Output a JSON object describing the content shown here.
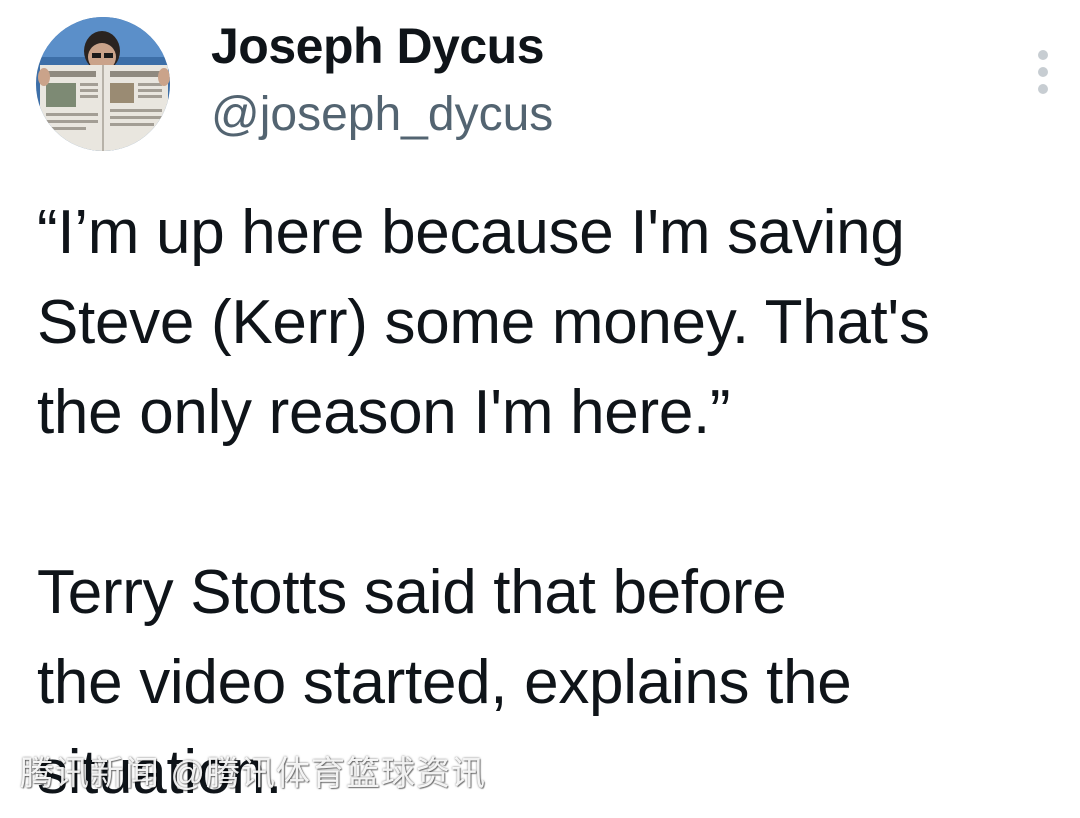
{
  "author": {
    "display_name": "Joseph Dycus",
    "handle": "@joseph_dycus",
    "avatar_icon": "avatar-photo-newspaper"
  },
  "menu": {
    "icon": "more-options-vertical-icon"
  },
  "tweet": {
    "paragraphs": [
      {
        "lines": [
          "“I’m up here because I'm saving",
          "Steve (Kerr) some money. That's",
          "the only reason I'm here.”"
        ]
      },
      {
        "lines": [
          "Terry Stotts said that before",
          "the video started, explains the",
          "situation."
        ]
      }
    ]
  },
  "watermark": {
    "text": "腾讯新闻 @腾讯体育篮球资讯"
  },
  "colors": {
    "text_primary": "#0f1419",
    "text_secondary": "#536471",
    "menu_dots": "#c7cdd2",
    "background": "#ffffff"
  }
}
